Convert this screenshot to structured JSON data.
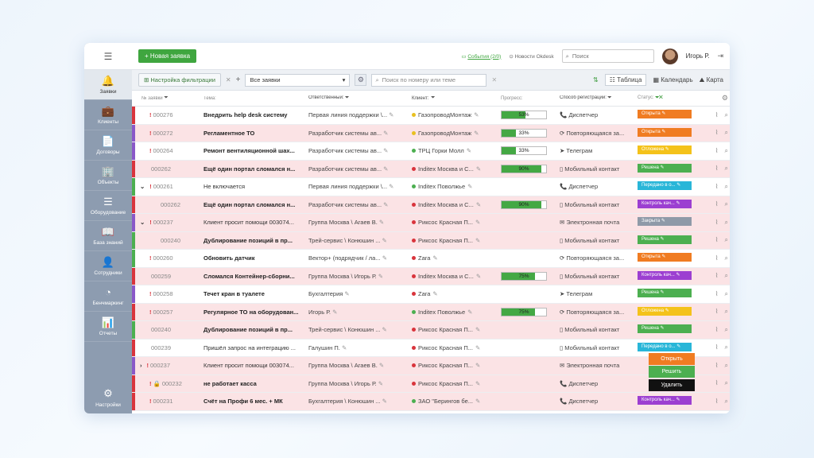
{
  "sidebar": {
    "items": [
      {
        "label": "Заявки",
        "icon": "bell-icon",
        "glyph": "🔔",
        "active": true
      },
      {
        "label": "Клиенты",
        "icon": "briefcase-icon",
        "glyph": "💼"
      },
      {
        "label": "Договоры",
        "icon": "documents-icon",
        "glyph": "📄"
      },
      {
        "label": "Объекты",
        "icon": "building-icon",
        "glyph": "🏢"
      },
      {
        "label": "Оборудование",
        "icon": "equipment-icon",
        "glyph": "☰"
      },
      {
        "label": "База знаний",
        "icon": "book-icon",
        "glyph": "📖"
      },
      {
        "label": "Сотрудники",
        "icon": "person-icon",
        "glyph": "👤"
      },
      {
        "label": "Бенчмаркинг",
        "icon": "gauge-icon",
        "glyph": "◔"
      },
      {
        "label": "Отчеты",
        "icon": "chart-icon",
        "glyph": "📊"
      }
    ],
    "settings": "Настройки"
  },
  "topbar": {
    "new_btn": "+ Новая заявка",
    "events": "События (2/0)",
    "news": "Новости Okdesk",
    "search": "Поиск",
    "user": "Игорь Р."
  },
  "toolbar": {
    "filter_btn": "Настройка фильтрации",
    "select": "Все заявки",
    "search": "Поиск по номеру или теме",
    "view_table": "Таблица",
    "view_calendar": "Календарь",
    "view_map": "Карта"
  },
  "headers": {
    "no": "№ заявки",
    "theme": "Тема:",
    "resp": "Ответственный:",
    "client": "Клиент:",
    "progress": "Прогресс:",
    "reg": "Способ регистрации:",
    "status": "Статус:"
  },
  "rows": [
    {
      "no": "000276",
      "mark": "!",
      "theme": "Внедрить help desk систему",
      "bold": true,
      "resp": "Первая линия поддержки \\...",
      "client": "ГазопроводМонтаж",
      "dot": "#e8c020",
      "prog": 53,
      "reg": "Диспетчер",
      "status": "Открыта",
      "scolor": "#f07c22",
      "bg": "white",
      "stripe": "#d9343c"
    },
    {
      "no": "000272",
      "mark": "!",
      "theme": "Регламентное ТО",
      "bold": true,
      "resp": "Разработчик системы ав...",
      "client": "ГазопроводМонтаж",
      "dot": "#e8c020",
      "prog": 33,
      "reg": "Повторяющаяся за...",
      "status": "Открыта",
      "scolor": "#f07c22",
      "bg": "pink",
      "stripe": "#8a58c8"
    },
    {
      "no": "000264",
      "mark": "!",
      "theme": "Ремонт вентиляционной шах...",
      "bold": true,
      "resp": "Разработчик системы ав...",
      "client": "ТРЦ Горки Молл",
      "dot": "#4caf50",
      "prog": 33,
      "reg": "Телеграм",
      "status": "Отложена",
      "scolor": "#f4c21a",
      "bg": "white",
      "stripe": "#8a58c8"
    },
    {
      "no": "000262",
      "mark": "",
      "theme": "Ещё один портал сломался н...",
      "bold": true,
      "resp": "Разработчик системы ав...",
      "client": "Inditex Москва и С...",
      "dot": "#d9343c",
      "prog": 90,
      "reg": "Мобильный контакт",
      "status": "Решена",
      "scolor": "#4caf50",
      "bg": "pink",
      "stripe": "#d9343c"
    },
    {
      "no": "000261",
      "mark": "!",
      "theme": "Не включается",
      "bold": false,
      "resp": "Первая линия поддержки \\...",
      "client": "Inditex Поволжье",
      "dot": "#4caf50",
      "prog": null,
      "reg": "Диспетчер",
      "status": "Передано в о...",
      "scolor": "#29b6d8",
      "bg": "white",
      "stripe": "#4caf50",
      "caret": "⌄"
    },
    {
      "no": "000262",
      "mark": "",
      "theme": "Ещё один портал сломался н...",
      "bold": true,
      "resp": "Разработчик системы ав...",
      "client": "Inditex Москва и С...",
      "dot": "#d9343c",
      "prog": 90,
      "reg": "Мобильный контакт",
      "status": "Контроль кач...",
      "scolor": "#9c3fd1",
      "bg": "pink",
      "stripe": "#d9343c",
      "indent": true
    },
    {
      "no": "000237",
      "mark": "!",
      "theme": "Клиент просит помощи 003074...",
      "bold": false,
      "resp": "Группа Москва \\ Агаев В.",
      "client": "Риксос Красная П...",
      "dot": "#d9343c",
      "prog": null,
      "reg": "Электронная почта",
      "status": "Закрыта",
      "scolor": "#8f9aa8",
      "bg": "pink",
      "stripe": "#8a58c8",
      "caret": "⌄"
    },
    {
      "no": "000240",
      "mark": "",
      "theme": "Дублирование позиций в пр...",
      "bold": true,
      "resp": "Трей-сервис \\ Конюшин ...",
      "client": "Риксос Красная П...",
      "dot": "#d9343c",
      "prog": null,
      "reg": "Мобильный контакт",
      "status": "Решена",
      "scolor": "#4caf50",
      "bg": "pink",
      "stripe": "#4caf50",
      "indent": true
    },
    {
      "no": "000260",
      "mark": "!",
      "theme": "Обновить датчик",
      "bold": true,
      "resp": "Вектор+ (подрядчик / ла...",
      "client": "Zara",
      "dot": "#d9343c",
      "prog": null,
      "reg": "Повторяющаяся за...",
      "status": "Открыта",
      "scolor": "#f07c22",
      "bg": "white",
      "stripe": "#4caf50"
    },
    {
      "no": "000259",
      "mark": "",
      "theme": "Сломался Контейнер-сборни...",
      "bold": true,
      "resp": "Группа Москва \\ Игорь Р.",
      "client": "Inditex Москва и С...",
      "dot": "#d9343c",
      "prog": 75,
      "reg": "Мобильный контакт",
      "status": "Контроль кач...",
      "scolor": "#9c3fd1",
      "bg": "pink",
      "stripe": "#d9343c"
    },
    {
      "no": "000258",
      "mark": "!",
      "theme": "Течет кран в туалете",
      "bold": true,
      "resp": "Бухгалтерия",
      "client": "Zara",
      "dot": "#d9343c",
      "prog": null,
      "reg": "Телеграм",
      "status": "Решена",
      "scolor": "#4caf50",
      "bg": "white",
      "stripe": "#8a58c8"
    },
    {
      "no": "000257",
      "mark": "!",
      "theme": "Регулярное ТО на оборудован...",
      "bold": true,
      "resp": "Игорь Р.",
      "client": "Inditex Поволжье",
      "dot": "#4caf50",
      "prog": 75,
      "reg": "Повторяющаяся за...",
      "status": "Отложена",
      "scolor": "#f4c21a",
      "bg": "pink",
      "stripe": "#d9343c"
    },
    {
      "no": "000240",
      "mark": "",
      "theme": "Дублирование позиций в пр...",
      "bold": true,
      "resp": "Трей-сервис \\ Конюшин ...",
      "client": "Риксос Красная П...",
      "dot": "#d9343c",
      "prog": null,
      "reg": "Мобильный контакт",
      "status": "Решена",
      "scolor": "#4caf50",
      "bg": "pink",
      "stripe": "#4caf50"
    },
    {
      "no": "000239",
      "mark": "",
      "theme": "Пришёл запрос на интеграцию ...",
      "bold": false,
      "resp": "Галушин П.",
      "client": "Риксос Красная П...",
      "dot": "#d9343c",
      "prog": null,
      "reg": "Мобильный контакт",
      "status": "Передано в о...",
      "scolor": "#29b6d8",
      "bg": "white",
      "stripe": "#d9343c"
    },
    {
      "no": "000237",
      "mark": "!",
      "theme": "Клиент просит помощи 003074...",
      "bold": false,
      "resp": "Группа Москва \\ Агаев В.",
      "client": "Риксос Красная П...",
      "dot": "#d9343c",
      "prog": null,
      "reg": "Электронная почта",
      "status": "",
      "scolor": "#4caf50",
      "bg": "pink",
      "stripe": "#8a58c8",
      "caret": "›"
    },
    {
      "no": "000232",
      "mark": "!",
      "theme": "не работает касса",
      "bold": true,
      "resp": "Группа Москва \\ Игорь Р.",
      "client": "Риксос Красная П...",
      "dot": "#d9343c",
      "prog": null,
      "reg": "Диспетчер",
      "status": "",
      "scolor": "#f07c22",
      "bg": "pink",
      "stripe": "#d9343c",
      "lock": true
    },
    {
      "no": "000231",
      "mark": "!",
      "theme": "Счёт на Профи 6 мес. + МК",
      "bold": true,
      "resp": "Бухгалтерия \\ Конюшин ...",
      "client": "ЗАО \"Берингов бе...",
      "dot": "#4caf50",
      "prog": null,
      "reg": "Диспетчер",
      "status": "Контроль кач...",
      "scolor": "#9c3fd1",
      "bg": "pink",
      "stripe": "#d9343c"
    }
  ],
  "context_menu": {
    "open": "Открыть",
    "solve": "Решить",
    "delete": "Удалить"
  },
  "reg_icons": {
    "Диспетчер": "📞",
    "Повторяющаяся за...": "⟳",
    "Телеграм": "➤",
    "Мобильный контакт": "▯",
    "Электронная почта": "✉"
  }
}
